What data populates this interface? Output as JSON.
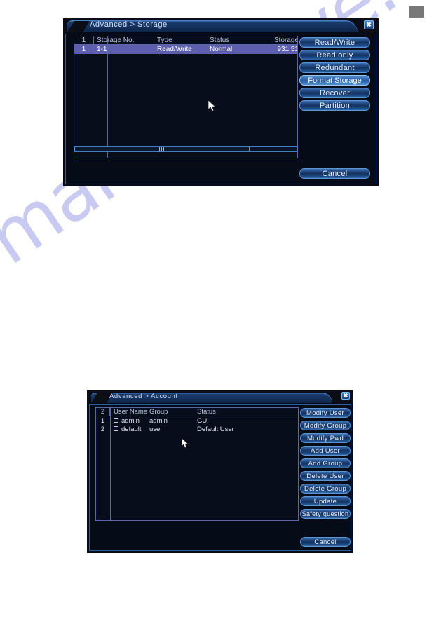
{
  "page": {
    "watermark": "manualshive.com",
    "grey_block_color": "#787878",
    "background": "#ffffff"
  },
  "storage_dialog": {
    "title": "Advanced > Storage",
    "close_label": "✖",
    "table": {
      "count": "1",
      "headers": [
        "Storage No.",
        "Type",
        "Status",
        "Storage"
      ],
      "rows": [
        {
          "index": "1",
          "storage_no": "1-1",
          "type": "Read/Write",
          "status": "Normal",
          "storage": "931.51",
          "selected": true
        }
      ]
    },
    "buttons": [
      {
        "label": "Read/Write",
        "highlighted": false
      },
      {
        "label": "Read only",
        "highlighted": false
      },
      {
        "label": "Redundant",
        "highlighted": false
      },
      {
        "label": "Format Storage",
        "highlighted": true
      },
      {
        "label": "Recover",
        "highlighted": false
      },
      {
        "label": "Partition",
        "highlighted": false
      }
    ],
    "cancel_label": "Cancel"
  },
  "account_dialog": {
    "title": "Advanced > Account",
    "close_label": "✖",
    "table": {
      "count": "2",
      "headers": [
        "User Name",
        "Group",
        "Status"
      ],
      "rows": [
        {
          "index": "1",
          "user_name": "admin",
          "group": "admin",
          "status": "GUI"
        },
        {
          "index": "2",
          "user_name": "default",
          "group": "user",
          "status": "Default User"
        }
      ]
    },
    "buttons": [
      {
        "label": "Modify User"
      },
      {
        "label": "Modify Group"
      },
      {
        "label": "Modify Pwd"
      },
      {
        "label": "Add User"
      },
      {
        "label": "Add Group"
      },
      {
        "label": "Delete User"
      },
      {
        "label": "Delete Group"
      },
      {
        "label": "Update"
      },
      {
        "label": "Safety question"
      }
    ],
    "cancel_label": "Cancel"
  }
}
